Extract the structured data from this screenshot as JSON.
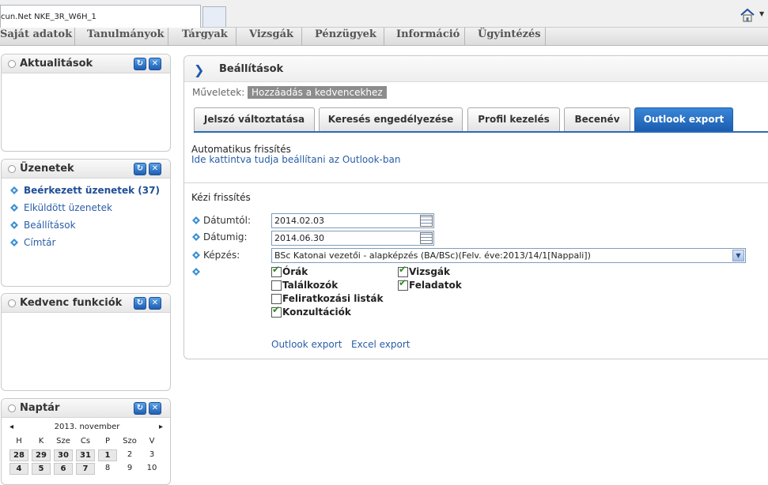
{
  "browser": {
    "tab_title": "cun.Net NKE_3R_W6H_1"
  },
  "menu": [
    {
      "label": "Saját adatok"
    },
    {
      "label": "Tanulmányok"
    },
    {
      "label": "Tárgyak"
    },
    {
      "label": "Vizsgák"
    },
    {
      "label": "Pénzügyek"
    },
    {
      "label": "Információ"
    },
    {
      "label": "Ügyintézés"
    }
  ],
  "sidebar": {
    "news": {
      "title": "Aktualitások"
    },
    "messages": {
      "title": "Üzenetek",
      "items": [
        {
          "label": "Beérkezett üzenetek (37)"
        },
        {
          "label": "Elküldött üzenetek"
        },
        {
          "label": "Beállítások"
        },
        {
          "label": "Címtár"
        }
      ]
    },
    "favorites": {
      "title": "Kedvenc funkciók"
    },
    "calendar": {
      "title": "Naptár",
      "month": "2013. november",
      "weekdays": [
        "H",
        "K",
        "Sze",
        "Cs",
        "P",
        "Szo",
        "V"
      ],
      "row1": [
        "28",
        "29",
        "30",
        "31",
        "1",
        "2",
        "3"
      ],
      "row2": [
        "4",
        "5",
        "6",
        "7",
        "8",
        "9",
        "10"
      ]
    }
  },
  "main": {
    "title": "Beállítások",
    "operations_label": "Műveletek:",
    "add_favorite": "Hozzáadás a kedvencekhez",
    "tabs": [
      {
        "label": "Jelszó változtatása"
      },
      {
        "label": "Keresés engedélyezése"
      },
      {
        "label": "Profil kezelés"
      },
      {
        "label": "Becenév"
      },
      {
        "label": "Outlook export"
      }
    ],
    "auto_refresh": "Automatikus frissítés",
    "auto_refresh_link": "Ide kattintva tudja beállítani az Outlook-ban",
    "manual_refresh": "Kézi frissítés",
    "date_from_label": "Dátumtól:",
    "date_from": "2014.02.03",
    "date_to_label": "Dátumig:",
    "date_to": "2014.06.30",
    "training_label": "Képzés:",
    "training_value": "BSc Katonai vezetői - alapképzés (BA/BSc)(Felv. éve:2013/14/1[Nappali])",
    "checkboxes": [
      {
        "label": "Órák",
        "checked": true
      },
      {
        "label": "Vizsgák",
        "checked": true
      },
      {
        "label": "Találkozók",
        "checked": false
      },
      {
        "label": "Feladatok",
        "checked": true
      },
      {
        "label": "Feliratkozási listák",
        "checked": false
      },
      {
        "label": "Konzultációk",
        "checked": true
      }
    ],
    "outlook_export": "Outlook export",
    "excel_export": "Excel export"
  }
}
